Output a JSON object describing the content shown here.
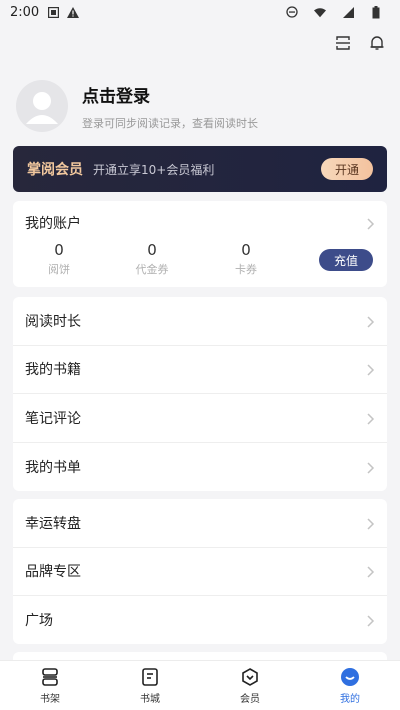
{
  "status_bar": {
    "time": "2:00"
  },
  "profile": {
    "login_label": "点击登录",
    "subtitle": "登录可同步阅读记录，查看阅读时长"
  },
  "vip": {
    "title": "掌阅会员",
    "description": "开通立享10+会员福利",
    "button_label": "开通"
  },
  "account": {
    "title": "我的账户",
    "stats": [
      {
        "value": "0",
        "label": "阅饼"
      },
      {
        "value": "0",
        "label": "代金券"
      },
      {
        "value": "0",
        "label": "卡券"
      }
    ],
    "charge_label": "充值"
  },
  "list_group_1": [
    {
      "label": "阅读时长"
    },
    {
      "label": "我的书籍"
    },
    {
      "label": "笔记评论"
    },
    {
      "label": "我的书单"
    }
  ],
  "list_group_2": [
    {
      "label": "幸运转盘"
    },
    {
      "label": "品牌专区"
    },
    {
      "label": "广场"
    }
  ],
  "tabs": [
    {
      "label": "书架",
      "icon": "bookshelf-icon"
    },
    {
      "label": "书城",
      "icon": "bookstore-icon"
    },
    {
      "label": "会员",
      "icon": "member-icon"
    },
    {
      "label": "我的",
      "icon": "profile-icon",
      "active": true
    }
  ],
  "colors": {
    "accent": "#2f6fe0",
    "vip_bg": "#27273b",
    "vip_gold": "#f2c89e",
    "charge_bg": "#3d4c8a"
  }
}
